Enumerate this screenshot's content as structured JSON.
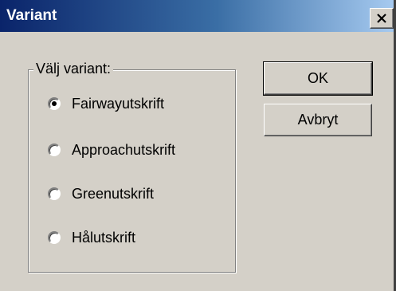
{
  "window": {
    "title": "Variant"
  },
  "group": {
    "label": "Välj variant:",
    "options": [
      {
        "label": "Fairwayutskrift",
        "selected": true
      },
      {
        "label": "Approachutskrift",
        "selected": false
      },
      {
        "label": "Greenutskrift",
        "selected": false
      },
      {
        "label": "Hålutskrift",
        "selected": false
      }
    ]
  },
  "buttons": {
    "ok": "OK",
    "cancel": "Avbryt"
  },
  "icons": {
    "close": "close-icon"
  },
  "colors": {
    "title_bar_start": "#0a246a",
    "title_bar_end": "#a6caf0",
    "face": "#d4d0c8"
  }
}
